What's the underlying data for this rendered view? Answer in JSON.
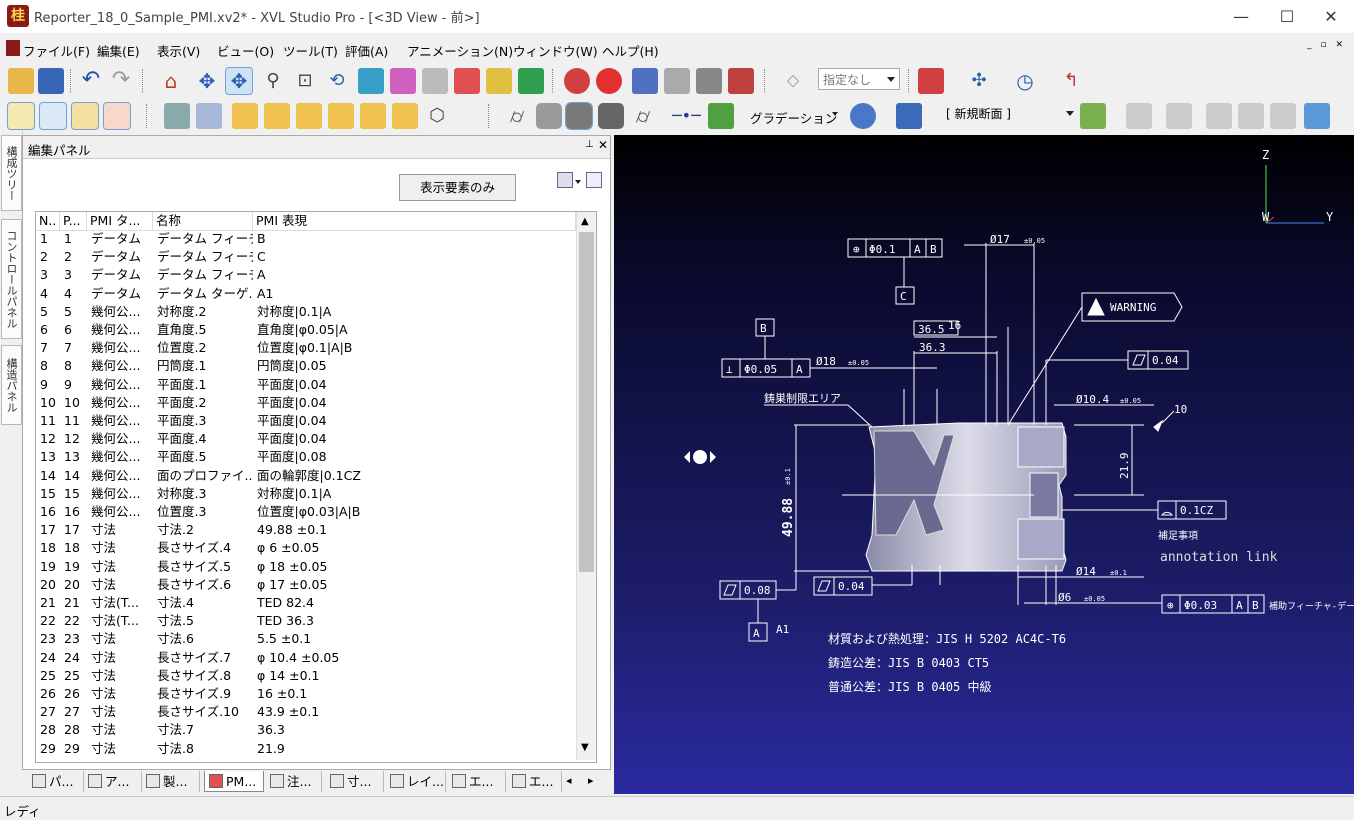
{
  "window": {
    "title": "Reporter_18_0_Sample_PMI.xv2* - XVL Studio Pro - [<3D View - 前>]",
    "app_icon_glyph": "桂"
  },
  "menu": [
    "ファイル(F)",
    "編集(E)",
    "表示(V)",
    "ビュー(O)",
    "ツール(T)",
    "評価(A)",
    "アニメーション(N)",
    "ウィンドウ(W)",
    "ヘルプ(H)"
  ],
  "toolbar": {
    "filter_combo": "指定なし",
    "gradation_label": "グラデーション",
    "section_combo": "[ 新規断面 ]"
  },
  "side_tabs": [
    "構成ツリー",
    "コントロールパネル",
    "構造パネル"
  ],
  "panel": {
    "title": "編集パネル",
    "show_only_button": "表示要素のみ",
    "columns": [
      "N..",
      "P...",
      "PMI タ...",
      "名称",
      "PMI 表現"
    ],
    "rows": [
      [
        "1",
        "1",
        "データム",
        "データム フィーチ...",
        "B"
      ],
      [
        "2",
        "2",
        "データム",
        "データム フィーチ...",
        "C"
      ],
      [
        "3",
        "3",
        "データム",
        "データム フィーチ...",
        "A"
      ],
      [
        "4",
        "4",
        "データム",
        "データム ターゲ...",
        "A1"
      ],
      [
        "5",
        "5",
        "幾何公...",
        "対称度.2",
        "対称度|0.1|A"
      ],
      [
        "6",
        "6",
        "幾何公...",
        "直角度.5",
        "直角度|φ0.05|A"
      ],
      [
        "7",
        "7",
        "幾何公...",
        "位置度.2",
        "位置度|φ0.1|A|B"
      ],
      [
        "8",
        "8",
        "幾何公...",
        "円筒度.1",
        "円筒度|0.05"
      ],
      [
        "9",
        "9",
        "幾何公...",
        "平面度.1",
        "平面度|0.04"
      ],
      [
        "10",
        "10",
        "幾何公...",
        "平面度.2",
        "平面度|0.04"
      ],
      [
        "11",
        "11",
        "幾何公...",
        "平面度.3",
        "平面度|0.04"
      ],
      [
        "12",
        "12",
        "幾何公...",
        "平面度.4",
        "平面度|0.04"
      ],
      [
        "13",
        "13",
        "幾何公...",
        "平面度.5",
        "平面度|0.08"
      ],
      [
        "14",
        "14",
        "幾何公...",
        "面のプロファイ...",
        "面の輪郭度|0.1CZ"
      ],
      [
        "15",
        "15",
        "幾何公...",
        "対称度.3",
        "対称度|0.1|A"
      ],
      [
        "16",
        "16",
        "幾何公...",
        "位置度.3",
        "位置度|φ0.03|A|B"
      ],
      [
        "17",
        "17",
        "寸法",
        "寸法.2",
        "49.88 ±0.1"
      ],
      [
        "18",
        "18",
        "寸法",
        "長さサイズ.4",
        "φ 6 ±0.05"
      ],
      [
        "19",
        "19",
        "寸法",
        "長さサイズ.5",
        "φ 18 ±0.05"
      ],
      [
        "20",
        "20",
        "寸法",
        "長さサイズ.6",
        "φ 17 ±0.05"
      ],
      [
        "21",
        "21",
        "寸法(T...",
        "寸法.4",
        "TED 82.4"
      ],
      [
        "22",
        "22",
        "寸法(T...",
        "寸法.5",
        "TED 36.3"
      ],
      [
        "23",
        "23",
        "寸法",
        "寸法.6",
        "5.5 ±0.1"
      ],
      [
        "24",
        "24",
        "寸法",
        "長さサイズ.7",
        "φ 10.4 ±0.05"
      ],
      [
        "25",
        "25",
        "寸法",
        "長さサイズ.8",
        "φ 14 ±0.1"
      ],
      [
        "26",
        "26",
        "寸法",
        "長さサイズ.9",
        "16 ±0.1"
      ],
      [
        "27",
        "27",
        "寸法",
        "長さサイズ.10",
        "43.9 ±0.1"
      ],
      [
        "28",
        "28",
        "寸法",
        "寸法.7",
        "36.3"
      ],
      [
        "29",
        "29",
        "寸法",
        "寸法.8",
        "21.9"
      ]
    ],
    "bottom_tabs": [
      "パ...",
      "ア...",
      "製...",
      "PM...",
      "注...",
      "寸...",
      "レイ...",
      "エ...",
      "エ..."
    ]
  },
  "view": {
    "axes": {
      "z": "Z",
      "y": "Y",
      "w": "W"
    },
    "annotations": {
      "fcf_top": [
        "Φ0.1",
        "A",
        "B"
      ],
      "datum_c": "C",
      "datum_b": "B",
      "fcf_perp": [
        "⊥",
        "Φ0.05",
        "A"
      ],
      "dim_17": "Ø17",
      "dim_17_tol": "±0.05",
      "warning": "WARNING",
      "dim_365": "36.5",
      "dim_16": "16",
      "dim_363": "36.3",
      "dim_18": "Ø18",
      "dim_18_tol": "±0.05",
      "flat_004_top": "0.04",
      "cast_area": "鋳巣制限エリア",
      "dim_104": "Ø10.4",
      "dim_104_tol": "±0.05",
      "dim_10": "10",
      "dim_4988": "49.88",
      "dim_4988_tol": "±0.1",
      "dim_219": "21.9",
      "profile": "0.1CZ",
      "supplement": "補足事項",
      "annotation_link": "annotation link",
      "flat_008": "0.08",
      "flat_004_bottom": "0.04",
      "dim_14": "Ø14",
      "dim_14_tol": "±0.1",
      "dim_6": "Ø6",
      "dim_6_tol": "±0.05",
      "fcf_bottom": [
        "Φ0.03",
        "A",
        "B"
      ],
      "aux_feature": "補助フィーチャ-データ",
      "datum_a": "A",
      "datum_a1": "A1",
      "note1": "材質および熱処理：JIS H 5202 AC4C-T6",
      "note2": "鋳造公差：JIS B 0403 CT5",
      "note3": "普通公差：JIS B 0405 中級"
    }
  },
  "status": {
    "text": "レディ"
  },
  "colors": {
    "accent": "#3399ff",
    "view_annotation": "#ffffff",
    "part_fill": "#c8c8d8"
  }
}
